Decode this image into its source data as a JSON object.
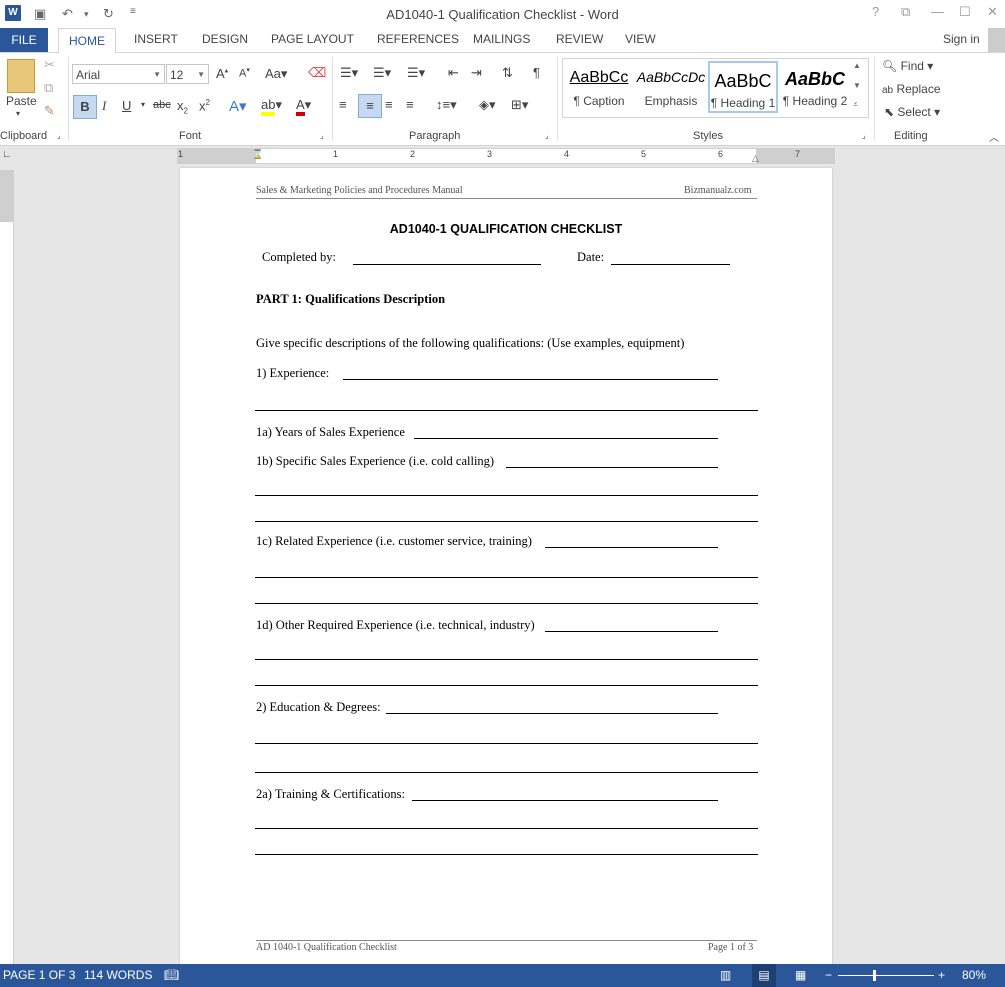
{
  "window": {
    "title": "AD1040-1 Qualification Checklist - Word",
    "help": "?",
    "min": "—",
    "max": "☐",
    "close": "✕"
  },
  "tabs": [
    "FILE",
    "HOME",
    "INSERT",
    "DESIGN",
    "PAGE LAYOUT",
    "REFERENCES",
    "MAILINGS",
    "REVIEW",
    "VIEW"
  ],
  "signin": "Sign in",
  "ribbon": {
    "clipboard": {
      "paste": "Paste",
      "label": "Clipboard"
    },
    "font": {
      "name": "Arial",
      "size": "12",
      "label": "Font"
    },
    "paragraph": {
      "label": "Paragraph"
    },
    "styles": {
      "label": "Styles",
      "items": [
        {
          "sample": "AaBbCc",
          "name": "¶ Caption"
        },
        {
          "sample": "AaBbCcDc",
          "name": "Emphasis"
        },
        {
          "sample": "AaBbC",
          "name": "¶ Heading 1"
        },
        {
          "sample": "AaBbC",
          "name": "¶ Heading 2"
        }
      ]
    },
    "editing": {
      "find": "Find",
      "replace": "Replace",
      "select": "Select",
      "label": "Editing"
    }
  },
  "ruler": [
    "1",
    "1",
    "2",
    "3",
    "4",
    "5",
    "6",
    "7"
  ],
  "document": {
    "header_left": "Sales & Marketing Policies and Procedures Manual",
    "header_right": "Bizmanualz.com",
    "title": "AD1040-1 QUALIFICATION CHECKLIST",
    "completed_by": "Completed by:",
    "date": "Date:",
    "part1": "PART 1:  Qualifications Description",
    "intro": "Give specific descriptions of the following qualifications: (Use examples, equipment)",
    "q1": "1)  Experience:",
    "q1a": "1a) Years of Sales Experience",
    "q1b": "1b) Specific Sales Experience (i.e. cold calling)",
    "q1c": "1c) Related Experience (i.e. customer service, training)",
    "q1d": "1d) Other Required Experience (i.e. technical, industry)",
    "q2": "2) Education & Degrees:",
    "q2a": "2a) Training & Certifications:",
    "footer_left": "AD 1040-1 Qualification Checklist",
    "footer_right": "Page 1 of 3"
  },
  "status": {
    "page": "PAGE 1 OF 3",
    "words": "114 WORDS",
    "zoom": "80%"
  }
}
